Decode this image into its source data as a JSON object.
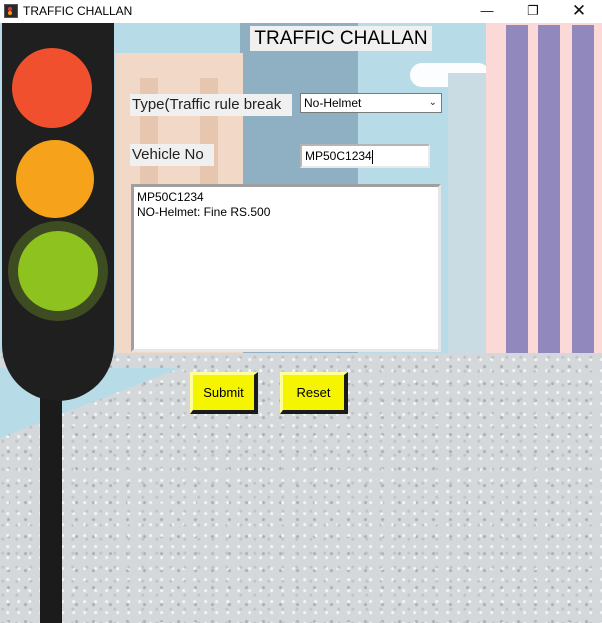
{
  "window": {
    "title": "TRAFFIC CHALLAN",
    "controls": {
      "minimize": "—",
      "maximize": "❐",
      "close": "✕"
    }
  },
  "form": {
    "heading": "TRAFFIC CHALLAN",
    "type_label": "Type(Traffic rule break",
    "type_selected": "No-Helmet",
    "vehicle_label": "Vehicle No",
    "vehicle_value": "MP50C1234",
    "output_lines": [
      "MP50C1234",
      "NO-Helmet: Fine RS.500"
    ],
    "submit_label": "Submit",
    "reset_label": "Reset"
  },
  "colors": {
    "button_fill": "#f5f500",
    "light_red": "#f0502d",
    "light_amber": "#f7a21b",
    "light_green": "#8ec21e"
  }
}
